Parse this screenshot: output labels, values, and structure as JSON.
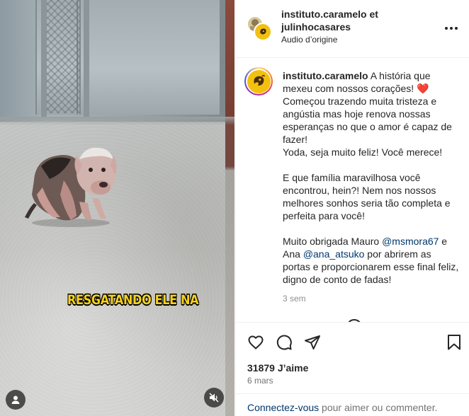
{
  "video": {
    "caption_overlay": "RESGATANDO ELE NA",
    "user_tag_icon": "person-icon",
    "mute_icon": "speaker-muted-icon"
  },
  "header": {
    "names": "instituto.caramelo et julinhocasares",
    "audio": "Audio d’origine",
    "more_icon": "more-horizontal-icon"
  },
  "comment": {
    "username": "instituto.caramelo",
    "line1": " A história que mexeu com nossos corações! ",
    "heart": "❤️",
    "line2": "Começou trazendo muita tristeza e angústia mas hoje renova nossas esperanças no que o amor é capaz de fazer!",
    "line3": "Yoda, seja muito feliz! Você merece!",
    "para2": "E que família maravilhosa você encontrou, hein?! Nem nos nossos melhores sonhos seria tão completa e perfeita para você!",
    "para3_a": "Muito obrigada Mauro ",
    "mention1": "@msmora67",
    "para3_b": " e Ana ",
    "mention2": "@ana_atsuko",
    "para3_c": " por abrirem as portas e proporcionarem esse final feliz, digno de conto de fadas!",
    "time": "3 sem"
  },
  "actions": {
    "like_icon": "heart-icon",
    "comment_icon": "comment-icon",
    "share_icon": "send-icon",
    "save_icon": "bookmark-icon"
  },
  "likes": "31879 J’aime",
  "date": "6 mars",
  "login": {
    "link": "Connectez-vous",
    "rest": " pour aimer ou commenter."
  },
  "colors": {
    "link": "#00376b",
    "text": "#262626",
    "muted": "#737373",
    "caption_yellow": "#f7d21a"
  }
}
